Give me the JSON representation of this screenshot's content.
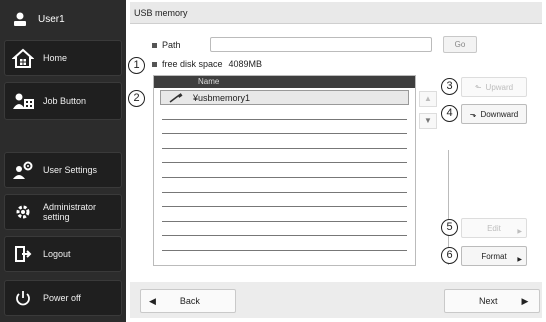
{
  "sidebar": {
    "user": "User1",
    "items": [
      {
        "label": "Home",
        "icon": "home-icon"
      },
      {
        "label": "Job Button",
        "icon": "job-button-icon"
      },
      {
        "label": "User Settings",
        "icon": "user-settings-icon"
      },
      {
        "label": "Administrator setting",
        "icon": "gear-icon"
      },
      {
        "label": "Logout",
        "icon": "logout-icon"
      },
      {
        "label": "Power off",
        "icon": "power-icon"
      }
    ]
  },
  "main": {
    "title": "USB memory",
    "path_label": "Path",
    "path_value": "",
    "go_label": "Go",
    "free_label": "free disk space",
    "free_value": "4089MB",
    "list_header": "Name",
    "files": [
      "¥usbmemory1"
    ],
    "buttons": {
      "upward": "Upward",
      "downward": "Downward",
      "edit": "Edit",
      "format": "Format"
    },
    "callouts": [
      "1",
      "2",
      "3",
      "4",
      "5",
      "6"
    ],
    "back_label": "Back",
    "next_label": "Next"
  },
  "colors": {
    "sidebar_bg": "#2c2c2c",
    "header_bg": "#3e3e3e",
    "disabled_text": "#bdbdbd"
  }
}
